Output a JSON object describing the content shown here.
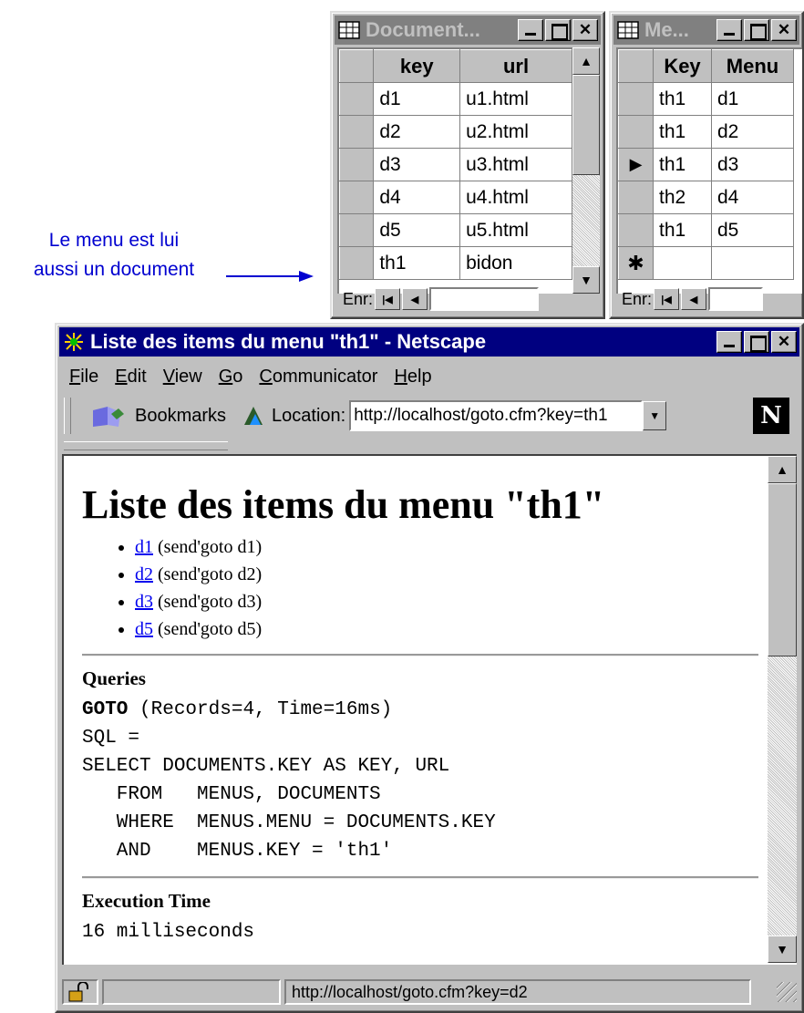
{
  "documents_window": {
    "title": "Document...",
    "columns": [
      "key",
      "url"
    ],
    "rows": [
      {
        "key": "d1",
        "url": "u1.html"
      },
      {
        "key": "d2",
        "url": "u2.html"
      },
      {
        "key": "d3",
        "url": "u3.html"
      },
      {
        "key": "d4",
        "url": "u4.html"
      },
      {
        "key": "d5",
        "url": "u5.html"
      },
      {
        "key": "th1",
        "url": "bidon"
      }
    ],
    "record_label": "Enr:"
  },
  "menus_window": {
    "title": "Me...",
    "columns": [
      "Key",
      "Menu"
    ],
    "rows": [
      {
        "key": "th1",
        "menu": "d1"
      },
      {
        "key": "th1",
        "menu": "d2"
      },
      {
        "key": "th1",
        "menu": "d3"
      },
      {
        "key": "th2",
        "menu": "d4"
      },
      {
        "key": "th1",
        "menu": "d5"
      }
    ],
    "new_record_marker": "✱",
    "current_marker": "▶",
    "record_label": "Enr:"
  },
  "annotation": {
    "line1": "Le menu est lui",
    "line2": "aussi un document"
  },
  "browser": {
    "title": "Liste des items du menu \"th1\" - Netscape",
    "menu": [
      "File",
      "Edit",
      "View",
      "Go",
      "Communicator",
      "Help"
    ],
    "bookmarks_label": "Bookmarks",
    "location_label": "Location:",
    "location_value": "http://localhost/goto.cfm?key=th1",
    "logo": "N",
    "status_url": "http://localhost/goto.cfm?key=d2"
  },
  "page": {
    "heading": "Liste des items du menu \"th1\"",
    "items": [
      {
        "link": "d1",
        "text": " (send'goto d1)"
      },
      {
        "link": "d2",
        "text": " (send'goto d2)"
      },
      {
        "link": "d3",
        "text": " (send'goto d3)"
      },
      {
        "link": "d5",
        "text": " (send'goto d5)"
      }
    ],
    "queries_heading": "Queries",
    "query_name": "GOTO",
    "query_stats": " (Records=4, Time=16ms)",
    "sql_label": "SQL =",
    "sql_lines": [
      "SELECT DOCUMENTS.KEY AS KEY, URL",
      "   FROM   MENUS, DOCUMENTS",
      "   WHERE  MENUS.MENU = DOCUMENTS.KEY",
      "   AND    MENUS.KEY = 'th1'"
    ],
    "exec_heading": "Execution Time",
    "exec_value": "16 milliseconds"
  }
}
